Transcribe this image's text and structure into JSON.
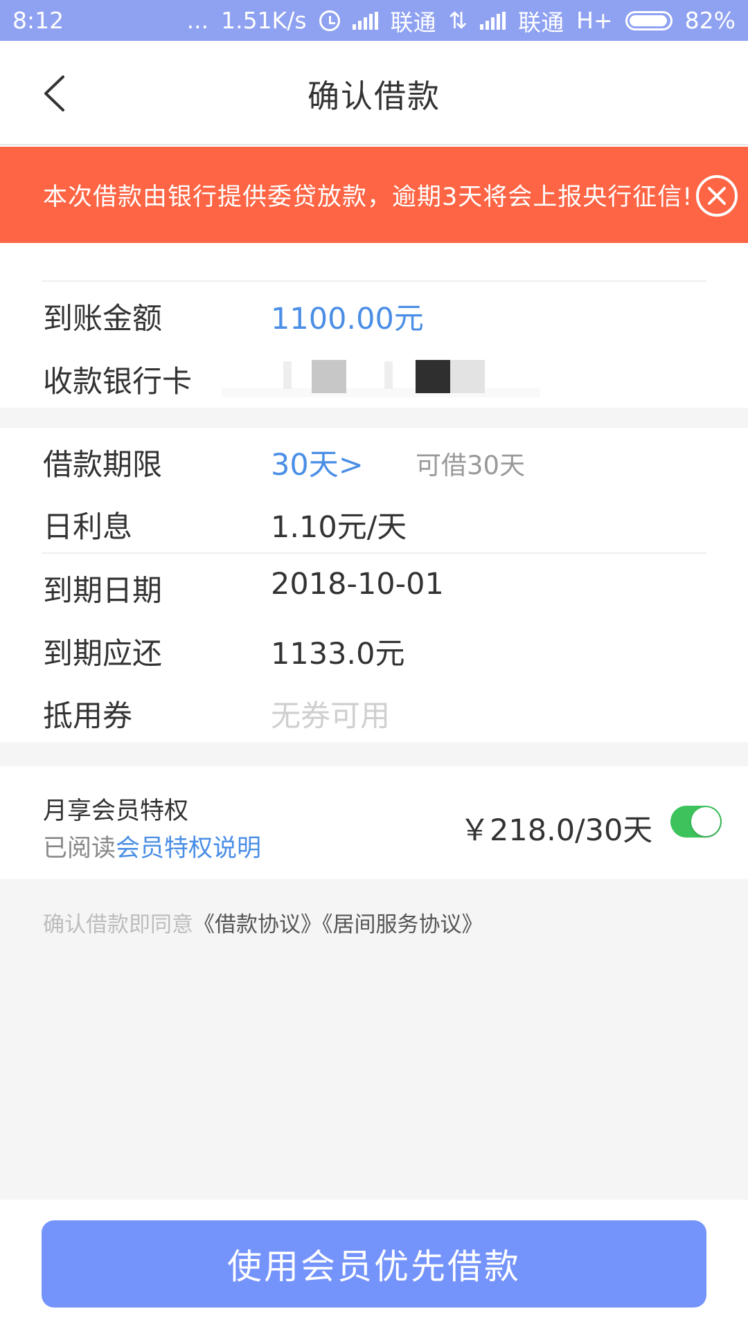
{
  "status_bar": {
    "time": "8:12",
    "dots": "...",
    "speed": "1.51K/s",
    "carrier1": "联通",
    "carrier2": "联通",
    "network": "H+",
    "battery": "82%"
  },
  "header": {
    "title": "确认借款",
    "back_icon": "chevron-left-icon"
  },
  "alert": {
    "text": "本次借款由银行提供委贷放款，逾期3天将会上报央行征信!",
    "close_icon": "close-circle-icon",
    "background": "#fd6545"
  },
  "receipt": {
    "amount_label": "到账金额",
    "amount_value": "1100.00元",
    "card_label": "收款银行卡"
  },
  "details": {
    "term_label": "借款期限",
    "term_value": "30天>",
    "term_hint": "可借30天",
    "daily_interest_label": "日利息",
    "daily_interest_value": "1.10元/天",
    "due_date_label": "到期日期",
    "due_date_value": "2018-10-01",
    "due_amount_label": "到期应还",
    "due_amount_value": "1133.0元",
    "coupon_label": "抵用券",
    "coupon_value": "无券可用"
  },
  "membership": {
    "title": "月享会员特权",
    "read_prefix": "已阅读",
    "read_link": "会员特权说明",
    "price": "￥218.0/30天",
    "toggle_on": true,
    "toggle_color": "#3cc35c"
  },
  "agreement": {
    "prefix": "确认借款即同意",
    "doc1": "《借款协议》",
    "doc2": "《居间服务协议》"
  },
  "action": {
    "button_label": "使用会员优先借款",
    "button_color": "#7594fb"
  },
  "colors": {
    "accent_blue": "#4a8ee6",
    "status_bar": "#8fa1f1"
  }
}
